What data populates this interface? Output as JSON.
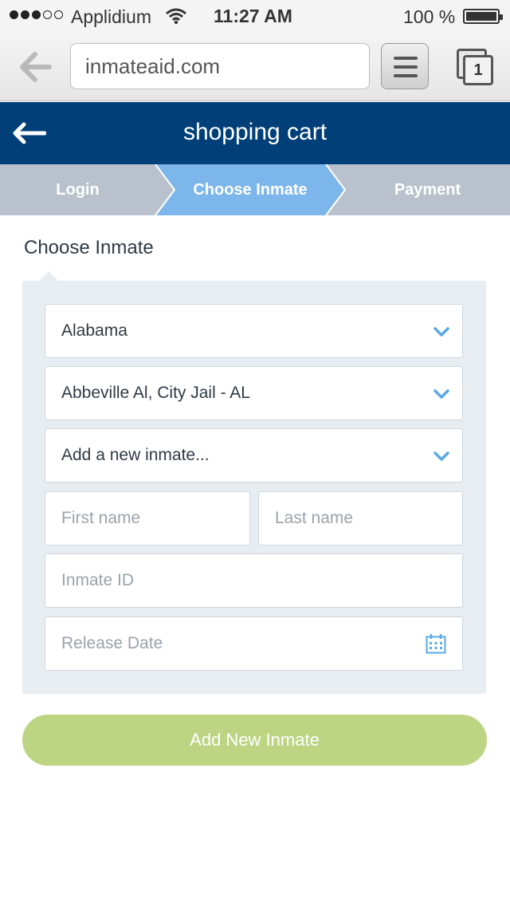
{
  "status_bar": {
    "carrier": "Applidium",
    "time": "11:27 AM",
    "battery": "100 %",
    "signal_bars": 3,
    "signal_total": 5
  },
  "browser": {
    "url": "inmateaid.com",
    "tab_count": "1"
  },
  "header": {
    "title": "shopping cart"
  },
  "steps": [
    {
      "label": "Login",
      "active": false
    },
    {
      "label": "Choose Inmate",
      "active": true
    },
    {
      "label": "Payment",
      "active": false
    }
  ],
  "section": {
    "title": "Choose Inmate"
  },
  "form": {
    "state_select": "Alabama",
    "facility_select": "Abbeville Al, City Jail - AL",
    "inmate_select": "Add a new inmate...",
    "first_name_placeholder": "First name",
    "last_name_placeholder": "Last name",
    "inmate_id_placeholder": "Inmate ID",
    "release_date_placeholder": "Release Date"
  },
  "actions": {
    "add_inmate_label": "Add New Inmate"
  },
  "colors": {
    "header_bg": "#003f78",
    "step_bg": "#b9c2cc",
    "step_active": "#7db6ea",
    "panel_bg": "#e8edf1",
    "accent_blue": "#5aa9e6",
    "button_green": "#bdd482"
  }
}
